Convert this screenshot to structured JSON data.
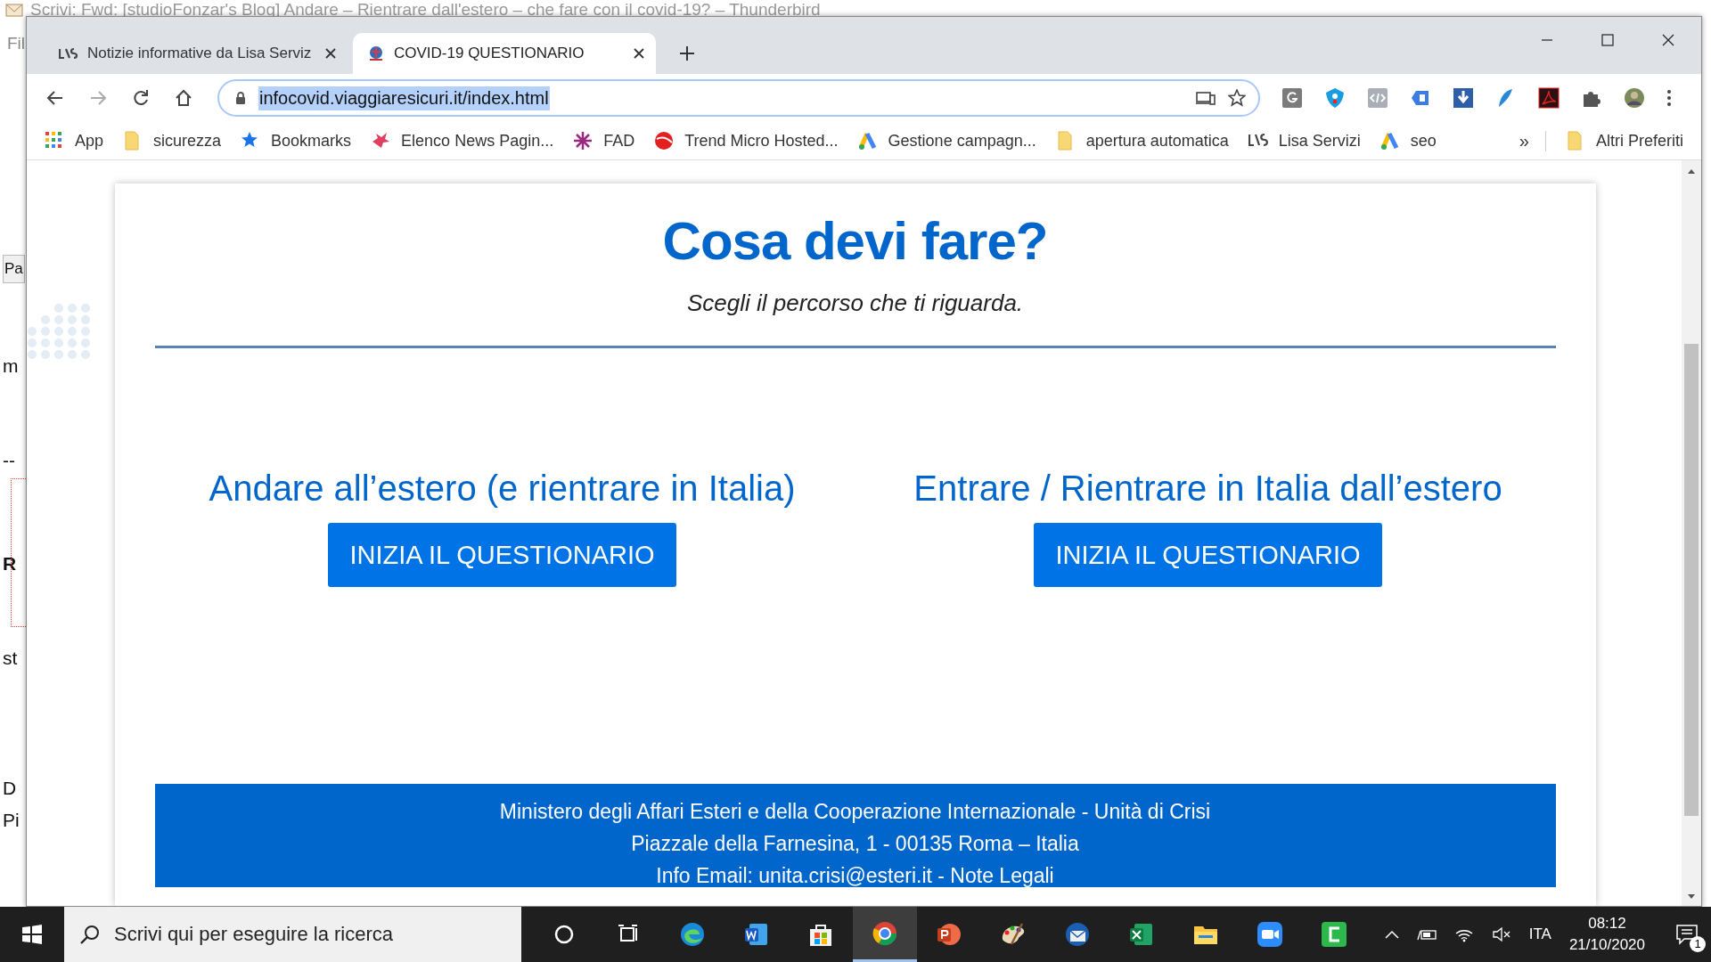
{
  "background_window": {
    "title": "Scrivi: Fwd: [studioFonzar's Blog] Andare – Rientrare dall'estero – che fare con il covid-19? – Thunderbird",
    "menu": "Fil",
    "fragments": [
      {
        "kind": "button",
        "text": "Pa"
      },
      {
        "kind": "text",
        "text": "m"
      },
      {
        "kind": "text",
        "text": "--"
      },
      {
        "kind": "bold",
        "text": "R"
      },
      {
        "kind": "text",
        "text": "st"
      },
      {
        "kind": "text",
        "text": "D"
      },
      {
        "kind": "text",
        "text": "Pi"
      }
    ]
  },
  "browser": {
    "tabs": [
      {
        "label": "Notizie informative da Lisa Serviz",
        "kind": "lisa",
        "selected": false
      },
      {
        "label": "COVID-19 QUESTIONARIO",
        "kind": "crisis",
        "selected": true
      }
    ],
    "address": "infocovid.viaggiaresicuri.it/index.html",
    "extensions": [
      {
        "kind": "g"
      },
      {
        "kind": "shield"
      },
      {
        "kind": "code"
      },
      {
        "kind": "tag"
      },
      {
        "kind": "download"
      },
      {
        "kind": "feather"
      },
      {
        "kind": "pdf"
      },
      {
        "kind": "puzzle"
      },
      {
        "kind": "avatar"
      }
    ],
    "bookmarks": [
      {
        "label": "App",
        "kind": "apps"
      },
      {
        "label": "sicurezza",
        "kind": "folder"
      },
      {
        "label": "Bookmarks",
        "kind": "star"
      },
      {
        "label": "Elenco News Pagin...",
        "kind": "news"
      },
      {
        "label": "FAD",
        "kind": "fad"
      },
      {
        "label": "Trend Micro Hosted...",
        "kind": "trend"
      },
      {
        "label": "Gestione campagn...",
        "kind": "ads"
      },
      {
        "label": "apertura automatica",
        "kind": "folder"
      },
      {
        "label": "Lisa Servizi",
        "kind": "lisa"
      },
      {
        "label": "seo",
        "kind": "ads"
      }
    ],
    "bookmarks_overflow": "»",
    "other_bookmarks": "Altri Preferiti"
  },
  "page": {
    "heading": "Cosa devi fare?",
    "subtitle": "Scegli il percorso che ti riguarda.",
    "paths": [
      {
        "title": "Andare all’estero (e rientrare in Italia)",
        "button": "INIZIA IL QUESTIONARIO"
      },
      {
        "title": "Entrare / Rientrare in Italia dall’estero",
        "button": "INIZIA IL QUESTIONARIO"
      }
    ],
    "footer": [
      "Ministero degli Affari Esteri e della Cooperazione Internazionale - Unità di Crisi",
      "Piazzale della Farnesina, 1 - 00135 Roma – Italia",
      "Info Email: unita.crisi@esteri.it - Note Legali"
    ]
  },
  "taskbar": {
    "search_placeholder": "Scrivi qui per eseguire la ricerca",
    "apps": [
      {
        "kind": "cortana",
        "selected": false
      },
      {
        "kind": "taskview",
        "selected": false
      },
      {
        "kind": "edge",
        "selected": false
      },
      {
        "kind": "word",
        "selected": false
      },
      {
        "kind": "store",
        "selected": false
      },
      {
        "kind": "chrome",
        "selected": true
      },
      {
        "kind": "powerpoint",
        "selected": false
      },
      {
        "kind": "paint",
        "selected": false
      },
      {
        "kind": "mail",
        "selected": false
      },
      {
        "kind": "excel",
        "selected": false
      },
      {
        "kind": "explorer",
        "selected": false
      },
      {
        "kind": "zoom",
        "selected": false
      },
      {
        "kind": "camtasia",
        "selected": false
      }
    ],
    "language": "ITA",
    "time": "08:12",
    "date": "21/10/2020",
    "notifications": "1"
  }
}
